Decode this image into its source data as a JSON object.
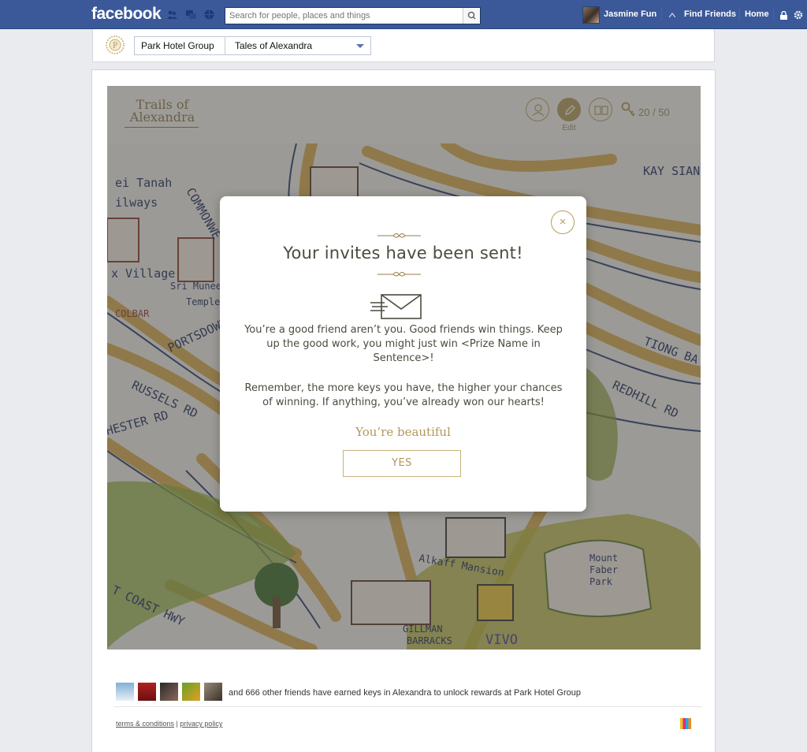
{
  "facebook": {
    "logo": "facebook",
    "search_placeholder": "Search for people, places and things",
    "user_name": "Jasmine Fun",
    "nav": {
      "find_friends": "Find Friends",
      "home": "Home"
    }
  },
  "page_header": {
    "page_select": "Park Hotel Group",
    "app_select": "Tales of Alexandra"
  },
  "app": {
    "logo_line1": "Trails of",
    "logo_line2": "Alexandra",
    "edit_label": "Edit",
    "keys": "20 / 50"
  },
  "modal": {
    "title": "Your invites have been sent!",
    "paragraph1": "You’re a good friend aren’t you. Good friends win things. Keep up the good work, you might just win <Prize Name in Sentence>!",
    "paragraph2": "Remember, the more keys you have, the higher your chances of winning. If anything, you’ve already won our hearts!",
    "subheading": "You’re beautiful",
    "button": "YES",
    "close": "×"
  },
  "footer": {
    "friends_text": "and 666 other friends have earned keys in Alexandra to unlock rewards at Park Hotel Group",
    "terms": "terms & conditions",
    "divider": "|",
    "privacy": "privacy policy"
  },
  "colors": {
    "fb_blue": "#3b5998",
    "gold": "#b79d5e",
    "map_ink": "#2a3f6e",
    "map_road": "#d6a94b"
  }
}
